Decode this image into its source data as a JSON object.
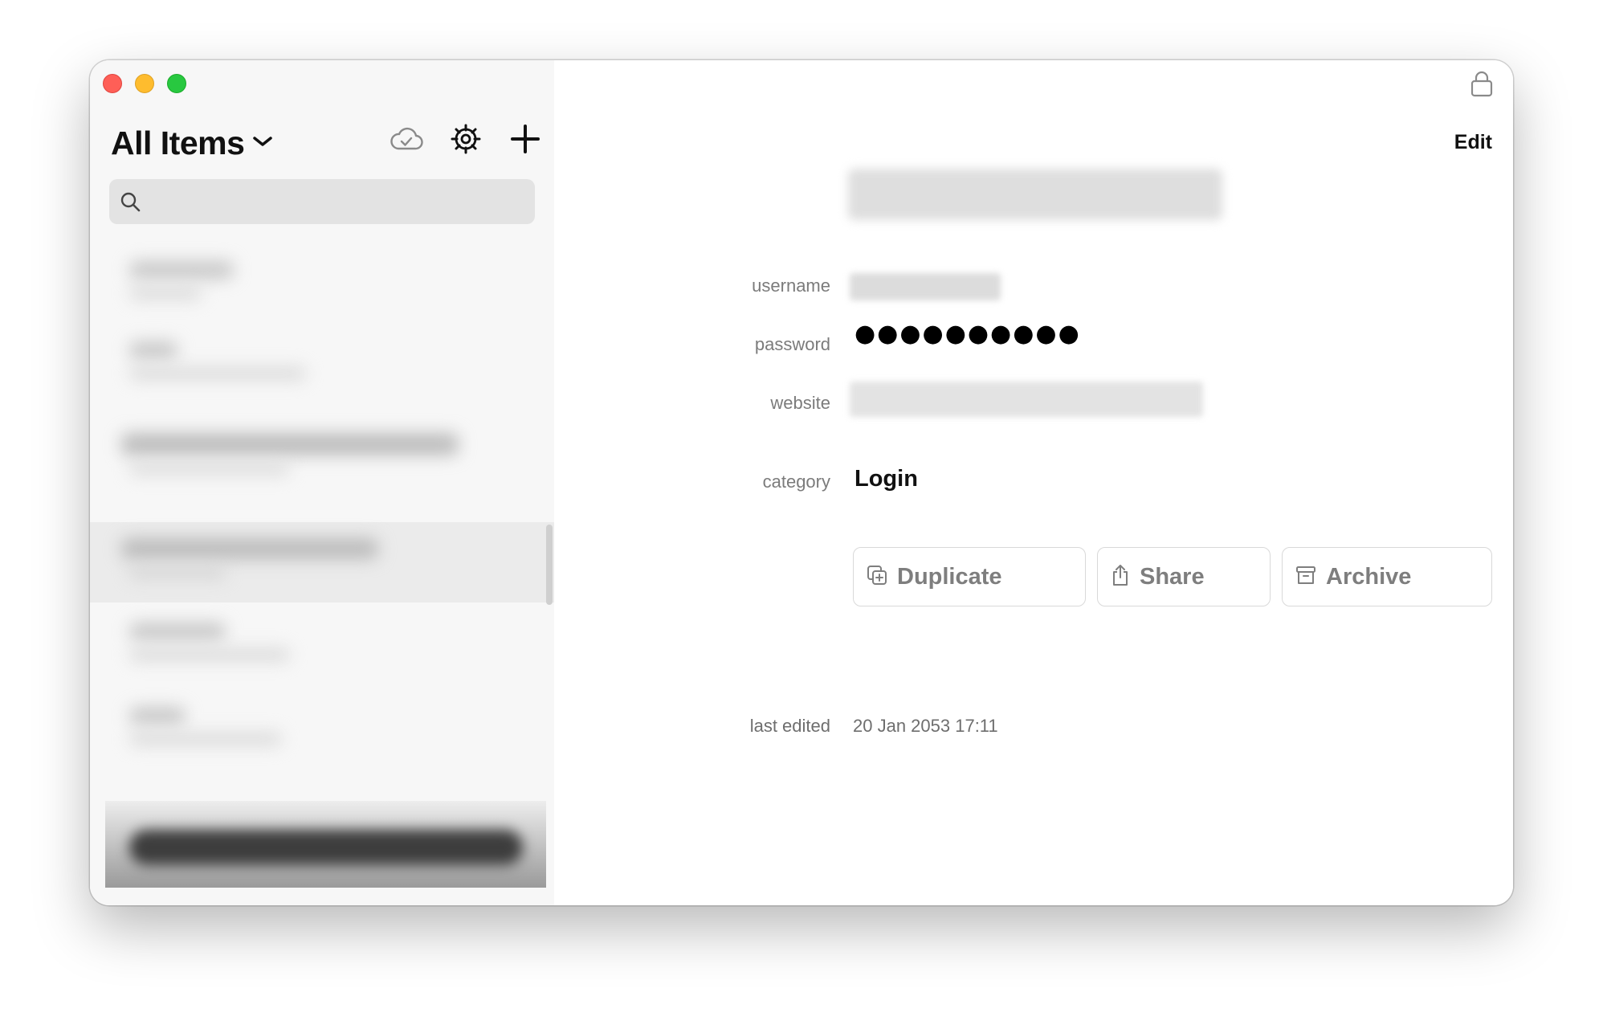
{
  "sidebar": {
    "title": "All Items",
    "search": {
      "placeholder": "",
      "value": ""
    }
  },
  "detail": {
    "edit_label": "Edit",
    "fields": {
      "username_label": "username",
      "password_label": "password",
      "password_value": "●●●●●●●●●●",
      "website_label": "website",
      "category_label": "category",
      "category_value": "Login",
      "last_edited_label": "last edited",
      "last_edited_value": "20 Jan 2053 17:11"
    },
    "actions": {
      "duplicate": "Duplicate",
      "share": "Share",
      "archive": "Archive"
    }
  },
  "icons": {
    "traffic": [
      "close-window-icon",
      "minimize-window-icon",
      "zoom-window-icon"
    ],
    "toolbar": [
      "cloud-sync-icon",
      "gear-icon",
      "plus-icon"
    ],
    "search": "search-icon",
    "lock": "lock-icon",
    "title_caret": "chevron-down-icon",
    "duplicate": "duplicate-icon",
    "share": "share-icon",
    "archive": "archive-icon"
  },
  "colors": {
    "traffic_red": "#fe5f57",
    "traffic_yellow": "#febc2e",
    "traffic_green": "#28c840",
    "sidebar_bg": "#f7f7f7",
    "label_gray": "#7b7b7b"
  }
}
